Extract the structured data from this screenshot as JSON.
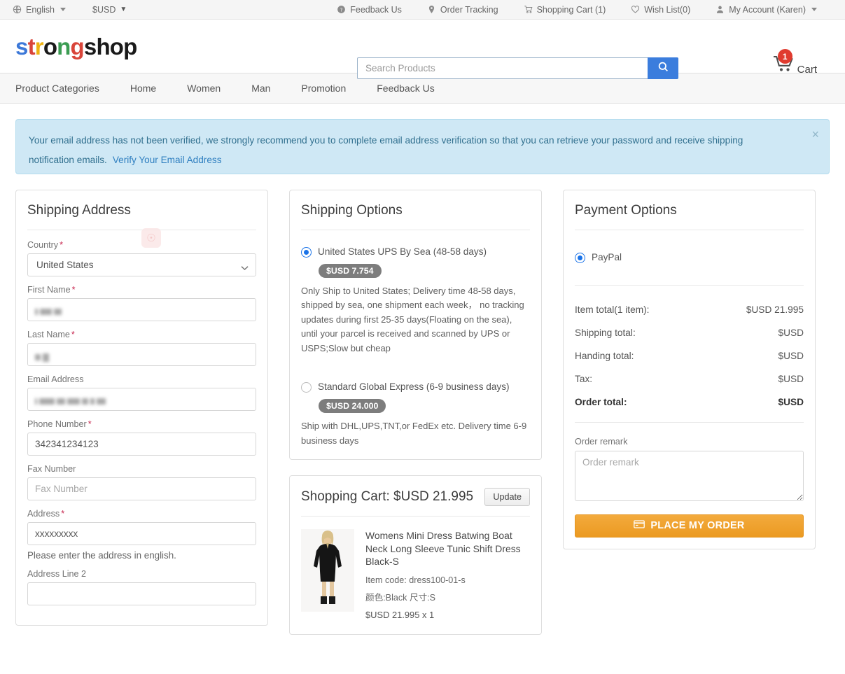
{
  "topbar": {
    "language": "English",
    "currency": "$USD",
    "links": [
      {
        "label": "Feedback Us",
        "icon": "help-circle-icon"
      },
      {
        "label": "Order Tracking",
        "icon": "map-pin-icon"
      },
      {
        "label": "Shopping Cart (1)",
        "icon": "cart-icon"
      },
      {
        "label": "Wish List(0)",
        "icon": "heart-icon"
      },
      {
        "label": "My Account (Karen)",
        "icon": "user-icon"
      }
    ]
  },
  "header": {
    "logo": {
      "p1": "s",
      "p2": "t",
      "p3": "r",
      "p4": "o",
      "p5": "n",
      "p6": "g",
      "p7": "shop"
    },
    "search_placeholder": "Search Products",
    "search_value": "",
    "cart_label": "Cart",
    "cart_count": "1"
  },
  "nav": {
    "items": [
      "Product Categories",
      "Home",
      "Women",
      "Man",
      "Promotion",
      "Feedback Us"
    ]
  },
  "alert": {
    "text": "Your email address has not been verified, we strongly recommend you to complete email address verification so that you can retrieve your password and receive shipping notification emails.",
    "link": "Verify Your Email Address",
    "close": "×"
  },
  "shipping_address": {
    "title": "Shipping Address",
    "fields": [
      {
        "label": "Country",
        "required": true,
        "type": "select",
        "value": "United States"
      },
      {
        "label": "First Name",
        "required": true,
        "type": "redacted",
        "value": ""
      },
      {
        "label": "Last Name",
        "required": true,
        "type": "redacted",
        "value": ""
      },
      {
        "label": "Email Address",
        "required": false,
        "type": "redacted",
        "value": ""
      },
      {
        "label": "Phone Number",
        "required": true,
        "type": "text",
        "value": "342341234123"
      },
      {
        "label": "Fax Number",
        "required": false,
        "type": "text",
        "value": "",
        "placeholder": "Fax Number"
      },
      {
        "label": "Address",
        "required": true,
        "type": "text",
        "value": "xxxxxxxxx"
      },
      {
        "label": "Address Line 2",
        "required": false,
        "type": "text",
        "value": ""
      }
    ],
    "address_hint": "Please enter the address in english."
  },
  "shipping_options": {
    "title": "Shipping Options",
    "options": [
      {
        "label": "United States UPS By Sea (48-58 days)",
        "price": "$USD 7.754",
        "selected": true,
        "description": "Only Ship to United States; Delivery time 48-58 days, shipped by sea, one shipment each week， no tracking updates during first 25-35 days(Floating on the sea), until your parcel is received and scanned by UPS or USPS;Slow but cheap"
      },
      {
        "label": "Standard Global Express (6-9 business days)",
        "price": "$USD 24.000",
        "selected": false,
        "description": "Ship with DHL,UPS,TNT,or FedEx etc. Delivery time 6-9 business days"
      }
    ]
  },
  "cart": {
    "title": "Shopping Cart: $USD 21.995",
    "update_label": "Update",
    "items": [
      {
        "name": "Womens Mini Dress Batwing Boat Neck Long Sleeve Tunic Shift Dress Black-S",
        "item_code": "Item code: dress100-01-s",
        "variant": "颜色:Black 尺寸:S",
        "price_qty": "$USD 21.995 x 1"
      }
    ]
  },
  "payment": {
    "title": "Payment Options",
    "methods": [
      {
        "label": "PayPal",
        "selected": true
      }
    ],
    "totals": [
      {
        "label": "Item total(1 item):",
        "value": "$USD 21.995",
        "bold": false
      },
      {
        "label": "Shipping total:",
        "value": "$USD",
        "bold": false
      },
      {
        "label": "Handing total:",
        "value": "$USD",
        "bold": false
      },
      {
        "label": "Tax:",
        "value": "$USD",
        "bold": false
      },
      {
        "label": "Order total:",
        "value": "$USD",
        "bold": true
      }
    ],
    "remark_label": "Order remark",
    "remark_placeholder": "Order remark",
    "remark_value": "",
    "place_order_label": "PLACE MY ORDER"
  },
  "colors": {
    "accent_blue": "#3b7ddd",
    "alert_bg": "#cfe8f5",
    "alert_text": "#31708f",
    "button_orange": "#eb9a22",
    "badge_red": "#e03b2f",
    "chip_gray": "#7d7d7d"
  }
}
